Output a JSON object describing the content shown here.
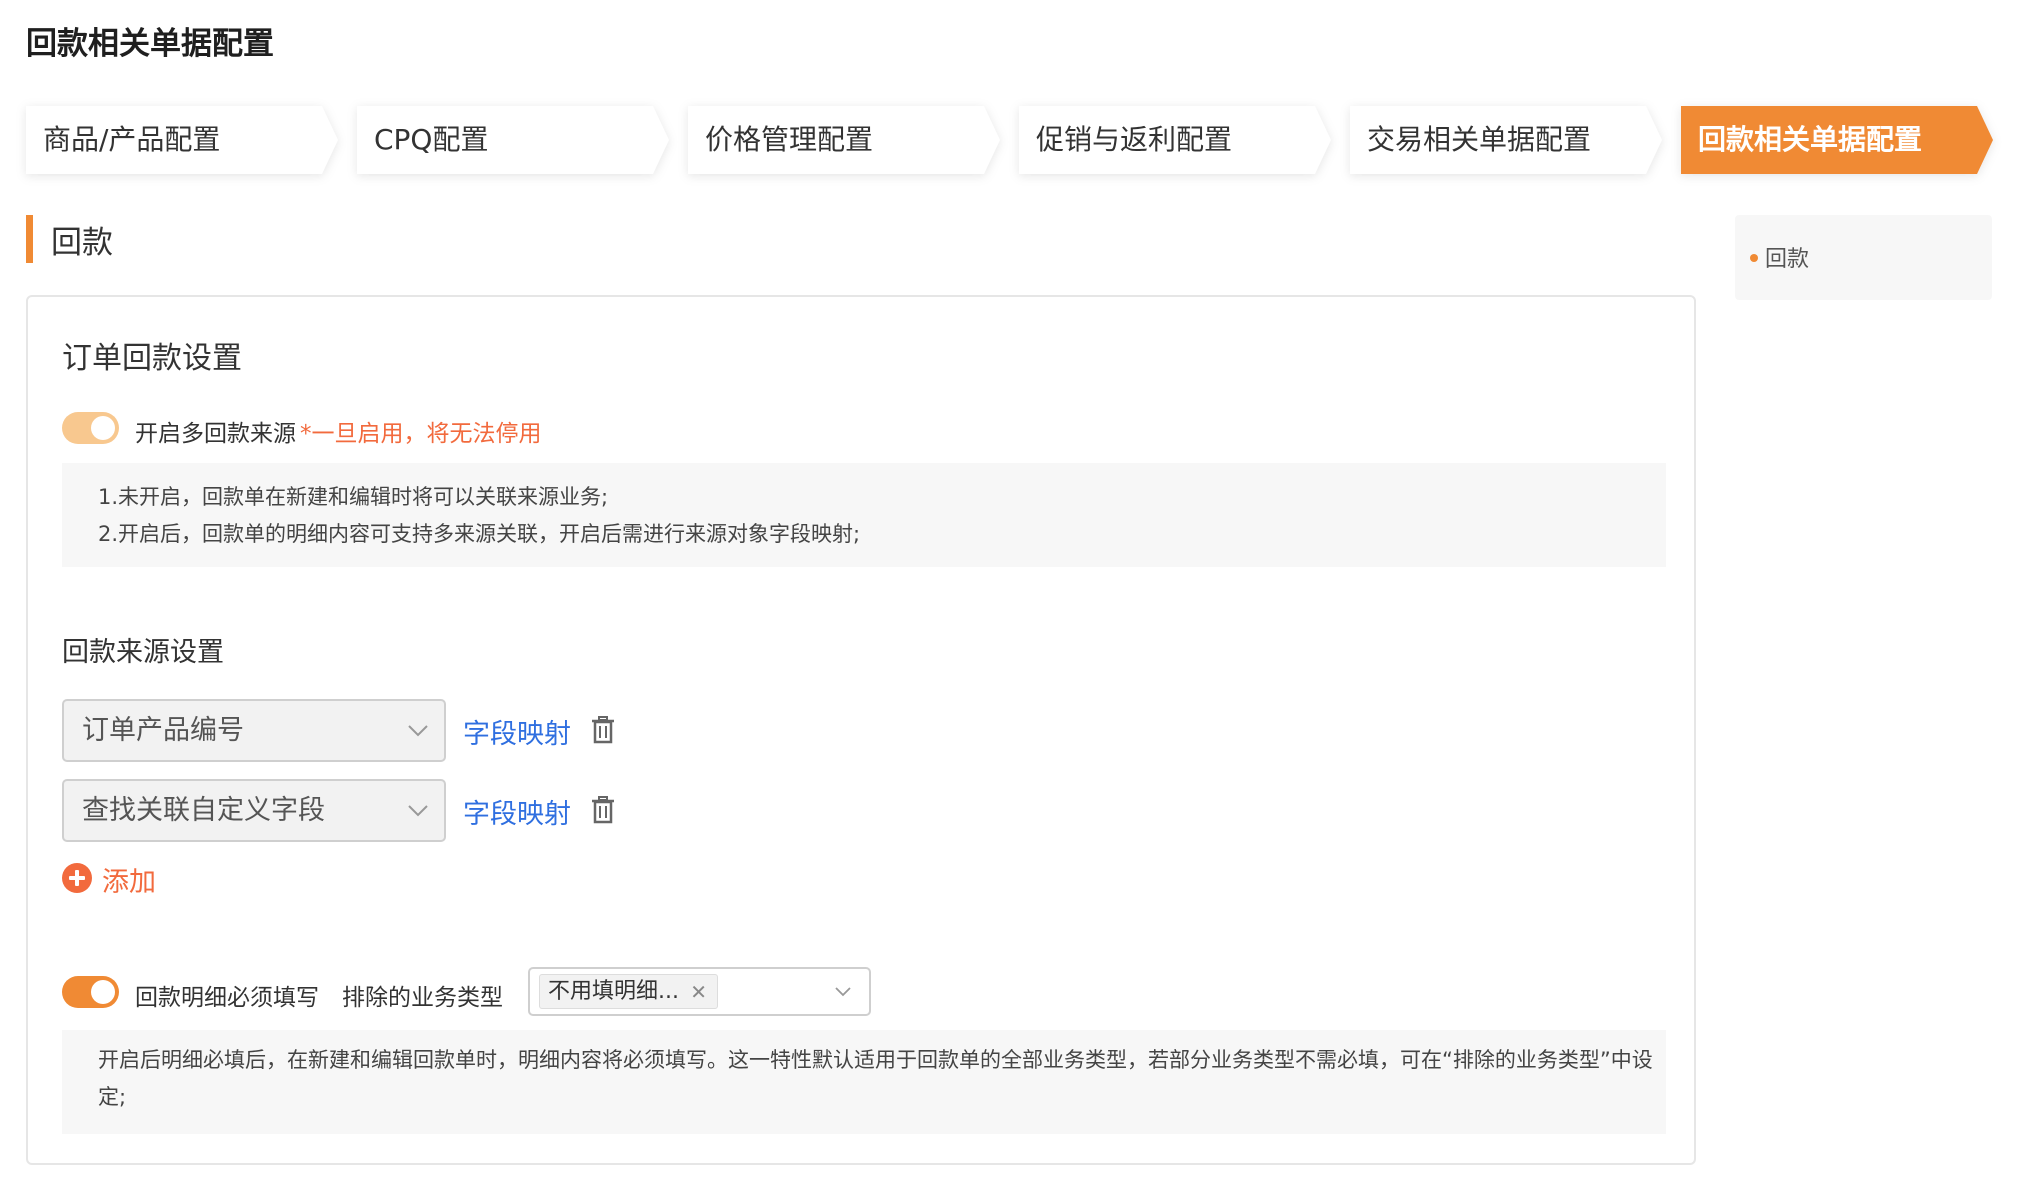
{
  "page_title": "回款相关单据配置",
  "steps": [
    {
      "label": "商品/产品配置",
      "active": false
    },
    {
      "label": "CPQ配置",
      "active": false
    },
    {
      "label": "价格管理配置",
      "active": false
    },
    {
      "label": "促销与返利配置",
      "active": false
    },
    {
      "label": "交易相关单据配置",
      "active": false
    },
    {
      "label": "回款相关单据配置",
      "active": true
    }
  ],
  "colors": {
    "accent": "#f08a34",
    "warn": "#f26a3d",
    "link": "#2f6fe0",
    "step_bg": "#ffffff",
    "toggle_dim": "#f8c88f"
  },
  "section": {
    "title": "回款"
  },
  "toc": {
    "items": [
      "回款"
    ]
  },
  "card": {
    "title": "订单回款设置",
    "multi_source": {
      "label": "开启多回款来源",
      "warning": "*一旦启用，将无法停用",
      "enabled": true,
      "notes": [
        "1.未开启，回款单在新建和编辑时将可以关联来源业务;",
        "2.开启后，回款单的明细内容可支持多来源关联，开启后需进行来源对象字段映射;"
      ]
    },
    "source_settings": {
      "title": "回款来源设置",
      "rows": [
        {
          "value": "订单产品编号",
          "link": "字段映射",
          "icon": "trash-icon"
        },
        {
          "value": "查找关联自定义字段",
          "link": "字段映射",
          "icon": "trash-icon"
        }
      ],
      "add_label": "添加"
    },
    "detail_required": {
      "label": "回款明细必须填写",
      "enabled": true,
      "exclude_label": "排除的业务类型",
      "exclude_tag": "不用填明细...",
      "note": "开启后明细必填后，在新建和编辑回款单时，明细内容将必须填写。这一特性默认适用于回款单的全部业务类型，若部分业务类型不需必填，可在“排除的业务类型”中设定;"
    }
  }
}
